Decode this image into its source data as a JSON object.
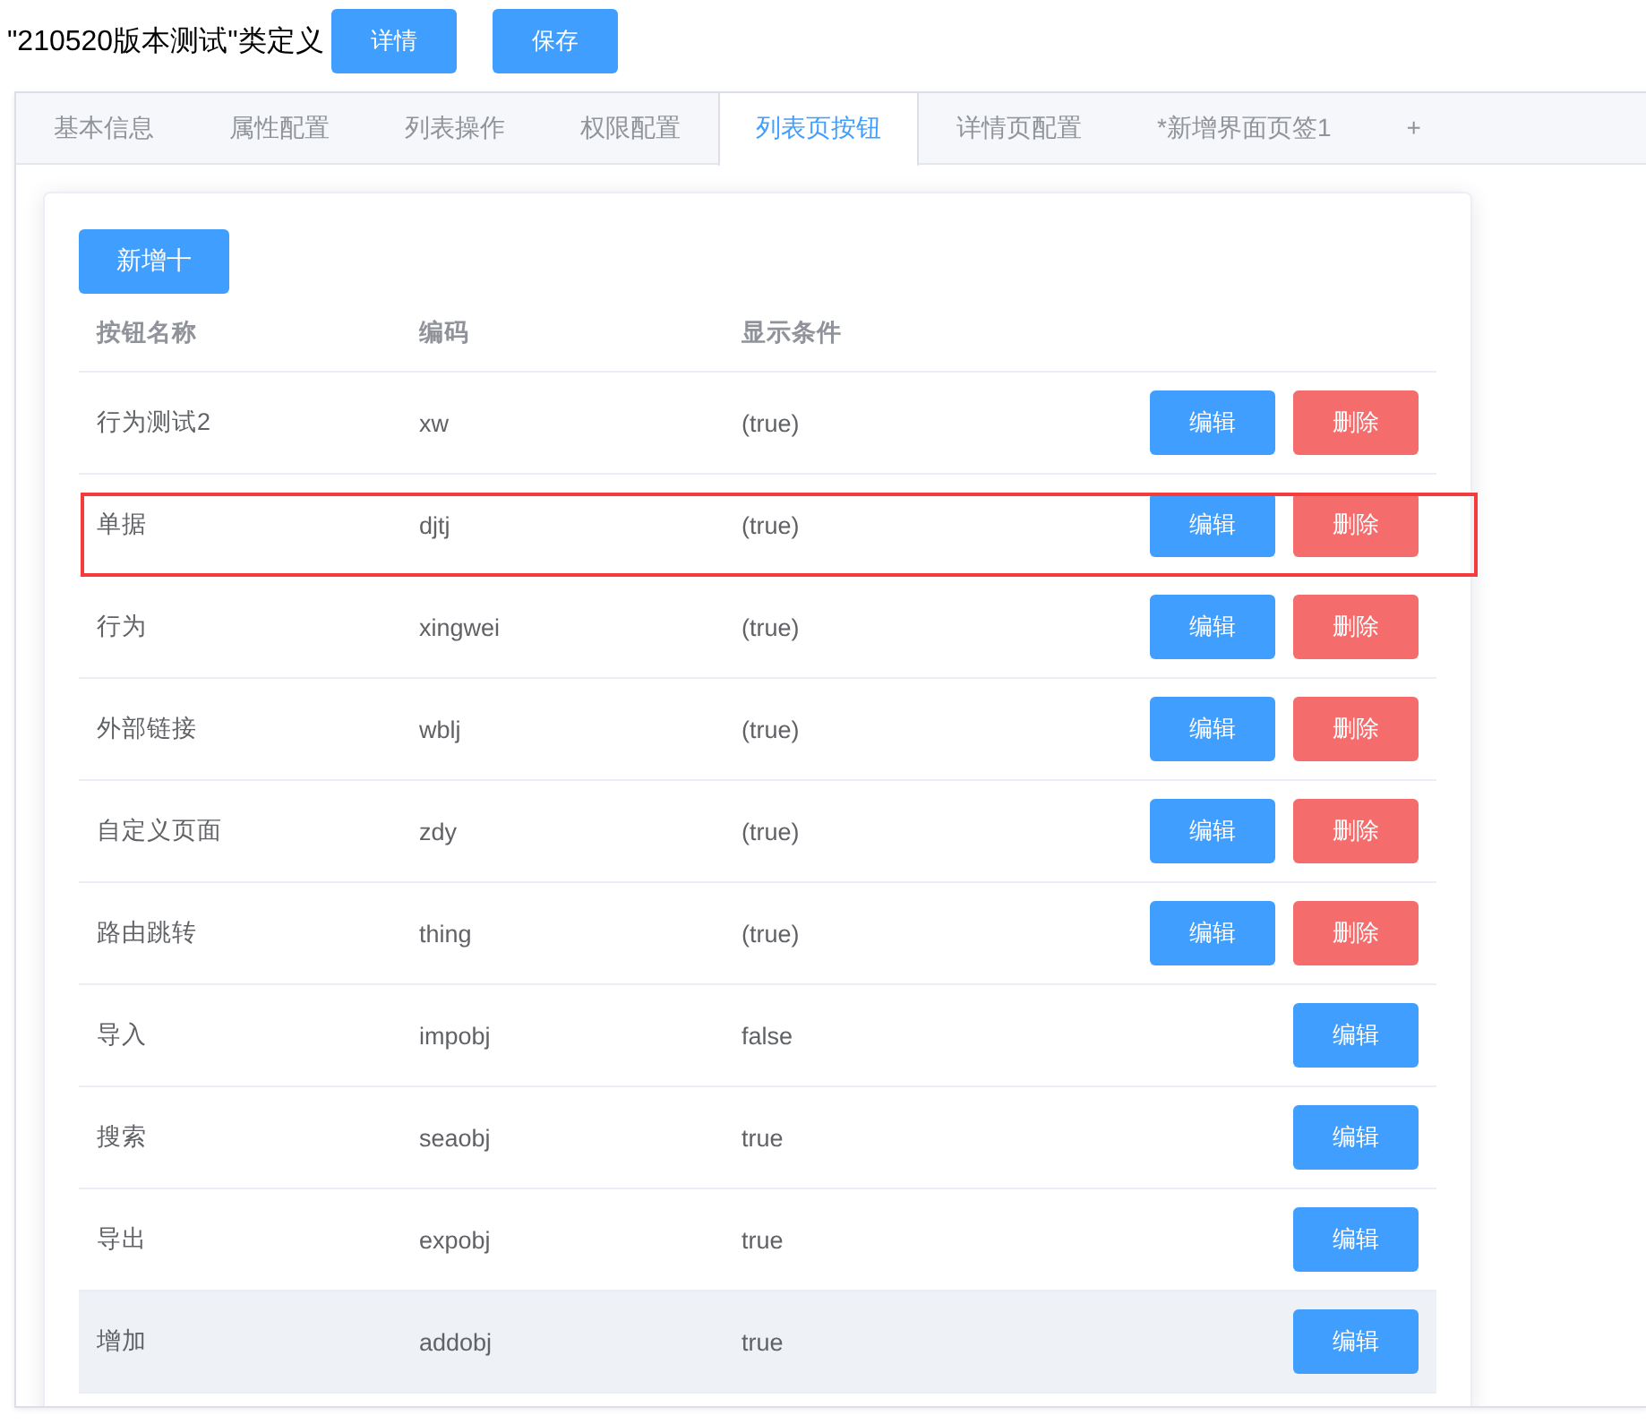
{
  "header": {
    "title": "\"210520版本测试\"类定义",
    "buttons": [
      "详情",
      "保存"
    ]
  },
  "tabs": [
    {
      "label": "基本信息",
      "selected": false
    },
    {
      "label": "属性配置",
      "selected": false
    },
    {
      "label": "列表操作",
      "selected": false
    },
    {
      "label": "权限配置",
      "selected": false
    },
    {
      "label": "列表页按钮",
      "selected": true
    },
    {
      "label": "详情页配置",
      "selected": false
    },
    {
      "label": "*新增界面页签1",
      "selected": false
    },
    {
      "label": "+",
      "selected": false
    }
  ],
  "add_button": "新增十",
  "table": {
    "columns": [
      "按钮名称",
      "编码",
      "显示条件"
    ],
    "rows": [
      {
        "cells": [
          "行为测试2",
          "xw",
          "(true)"
        ],
        "highlighted": false,
        "hovered": false,
        "actions": [
          {
            "kind": "edit",
            "label": "编辑"
          },
          {
            "kind": "delete",
            "label": "删除"
          }
        ]
      },
      {
        "cells": [
          "单据",
          "djtj",
          "(true)"
        ],
        "highlighted": true,
        "hovered": false,
        "actions": [
          {
            "kind": "edit",
            "label": "编辑"
          },
          {
            "kind": "delete",
            "label": "删除"
          }
        ]
      },
      {
        "cells": [
          "行为",
          "xingwei",
          "(true)"
        ],
        "highlighted": false,
        "hovered": false,
        "actions": [
          {
            "kind": "edit",
            "label": "编辑"
          },
          {
            "kind": "delete",
            "label": "删除"
          }
        ]
      },
      {
        "cells": [
          "外部链接",
          "wblj",
          "(true)"
        ],
        "highlighted": false,
        "hovered": false,
        "actions": [
          {
            "kind": "edit",
            "label": "编辑"
          },
          {
            "kind": "delete",
            "label": "删除"
          }
        ]
      },
      {
        "cells": [
          "自定义页面",
          "zdy",
          "(true)"
        ],
        "highlighted": false,
        "hovered": false,
        "actions": [
          {
            "kind": "edit",
            "label": "编辑"
          },
          {
            "kind": "delete",
            "label": "删除"
          }
        ]
      },
      {
        "cells": [
          "路由跳转",
          "thing",
          "(true)"
        ],
        "highlighted": false,
        "hovered": false,
        "actions": [
          {
            "kind": "edit",
            "label": "编辑"
          },
          {
            "kind": "delete",
            "label": "删除"
          }
        ]
      },
      {
        "cells": [
          "导入",
          "impobj",
          "false"
        ],
        "highlighted": false,
        "hovered": false,
        "actions": [
          {
            "kind": "edit",
            "label": "编辑"
          }
        ]
      },
      {
        "cells": [
          "搜索",
          "seaobj",
          "true"
        ],
        "highlighted": false,
        "hovered": false,
        "actions": [
          {
            "kind": "edit",
            "label": "编辑"
          }
        ]
      },
      {
        "cells": [
          "导出",
          "expobj",
          "true"
        ],
        "highlighted": false,
        "hovered": false,
        "actions": [
          {
            "kind": "edit",
            "label": "编辑"
          }
        ]
      },
      {
        "cells": [
          "增加",
          "addobj",
          "true"
        ],
        "highlighted": false,
        "hovered": true,
        "actions": [
          {
            "kind": "edit",
            "label": "编辑"
          }
        ]
      }
    ]
  }
}
